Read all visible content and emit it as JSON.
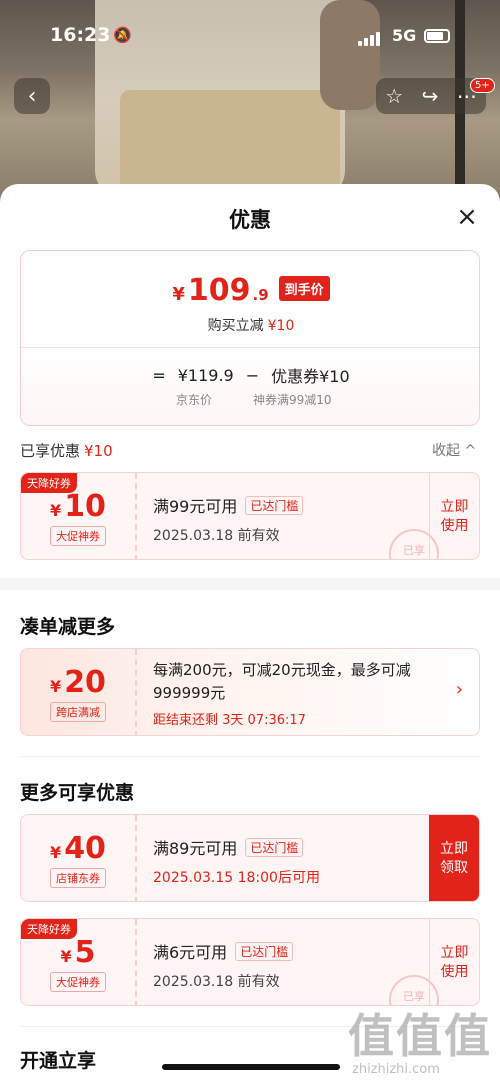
{
  "status": {
    "time": "16:23",
    "network": "5G"
  },
  "nav": {
    "back_icon": "‹",
    "badge": "5+"
  },
  "sheet": {
    "title": "优惠",
    "close_icon": "×",
    "price_card": {
      "currency": "¥",
      "final_int": "109",
      "final_dec": ".9",
      "price_tag": "到手价",
      "saving_label": "购买立减",
      "saving_value": "¥10",
      "eq": "=",
      "jd_price": "¥119.9",
      "minus": "−",
      "coupon_part": "优惠券¥10",
      "jd_price_label": "京东价",
      "coupon_label": "神券满99减10"
    },
    "enjoyed": {
      "label": "已享优惠",
      "value": "¥10",
      "collapse": "收起 ^"
    },
    "enjoyed_coupon": {
      "corner": "天降好券",
      "currency": "¥",
      "amount": "10",
      "type": "大促神券",
      "condition": "满99元可用",
      "cond_tag": "已达门槛",
      "date": "2025.03.18 前有效",
      "action": "立即使用",
      "stamp": "已享"
    },
    "more_section": {
      "title": "凑单减更多"
    },
    "promo": {
      "currency": "¥",
      "amount": "20",
      "type": "跨店满减",
      "desc": "每满200元，可减20元现金，最多可减999999元",
      "countdown": "距结束还剩 3天 07:36:17",
      "chevron": "›"
    },
    "extra_section": {
      "title": "更多可享优惠"
    },
    "extra_coupons": [
      {
        "corner": "",
        "currency": "¥",
        "amount": "40",
        "type": "店铺东券",
        "condition": "满89元可用",
        "cond_tag": "已达门槛",
        "date": "2025.03.15 18:00后可用",
        "action": "立即领取"
      },
      {
        "corner": "天降好券",
        "currency": "¥",
        "amount": "5",
        "type": "大促神券",
        "condition": "满6元可用",
        "cond_tag": "已达门槛",
        "date": "2025.03.18 前有效",
        "action": "立即使用",
        "stamp": "已享"
      }
    ],
    "open_section": {
      "title": "开通立享"
    }
  },
  "watermark": {
    "big": "值值值",
    "small": "zhizhizhi.com"
  },
  "colors": {
    "accent": "#e2231a"
  }
}
